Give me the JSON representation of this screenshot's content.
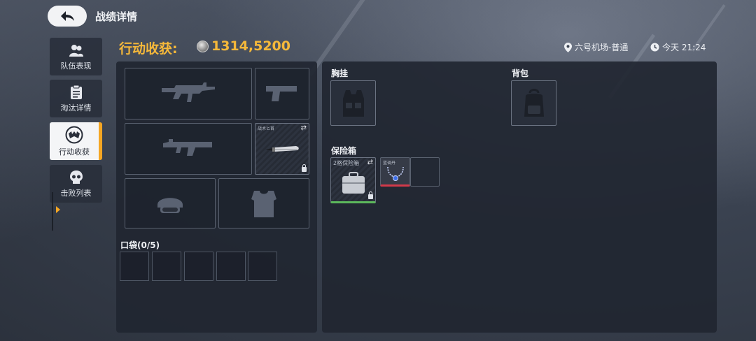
{
  "header": {
    "title": "战绩详情"
  },
  "sidebar": {
    "items": [
      {
        "label": "队伍表现",
        "icon": "team-icon",
        "active": false
      },
      {
        "label": "淘汰详情",
        "icon": "clipboard-icon",
        "active": false
      },
      {
        "label": "行动收获",
        "icon": "bat-emblem-icon",
        "active": true
      },
      {
        "label": "击败列表",
        "icon": "skull-icon",
        "active": false
      }
    ]
  },
  "loot": {
    "title": "行动收获:",
    "value": "1314,5200",
    "currency_icon": "coin-icon"
  },
  "meta": {
    "location": "六号机场-普通",
    "time": "今天 21:24"
  },
  "loadout": {
    "slots": [
      {
        "name": "primary-weapon-slot",
        "icon": "rifle-icon"
      },
      {
        "name": "pistol-slot",
        "icon": "pistol-icon"
      },
      {
        "name": "secondary-weapon-slot",
        "icon": "smg-icon"
      },
      {
        "name": "melee-slot",
        "caption": "战术匕首",
        "icon": "knife-icon",
        "locked": true
      },
      {
        "name": "helmet-slot",
        "icon": "helmet-icon"
      },
      {
        "name": "armor-slot",
        "icon": "armor-icon"
      }
    ],
    "pocket_label": "口袋(0/5)"
  },
  "gear": {
    "chest_rig_label": "胸挂",
    "backpack_label": "背包",
    "safebox_label": "保险箱",
    "safebox_item": {
      "caption": "2格保险箱",
      "icon": "case-icon",
      "locked": true,
      "rarity_color": "#5cb85c"
    },
    "safebox_contents": [
      {
        "caption": "蓝调丹",
        "icon": "necklace-icon",
        "rarity_color": "#d23a4a"
      }
    ]
  },
  "colors": {
    "accent": "#f5b83a",
    "active_tab": "#f5a623"
  }
}
